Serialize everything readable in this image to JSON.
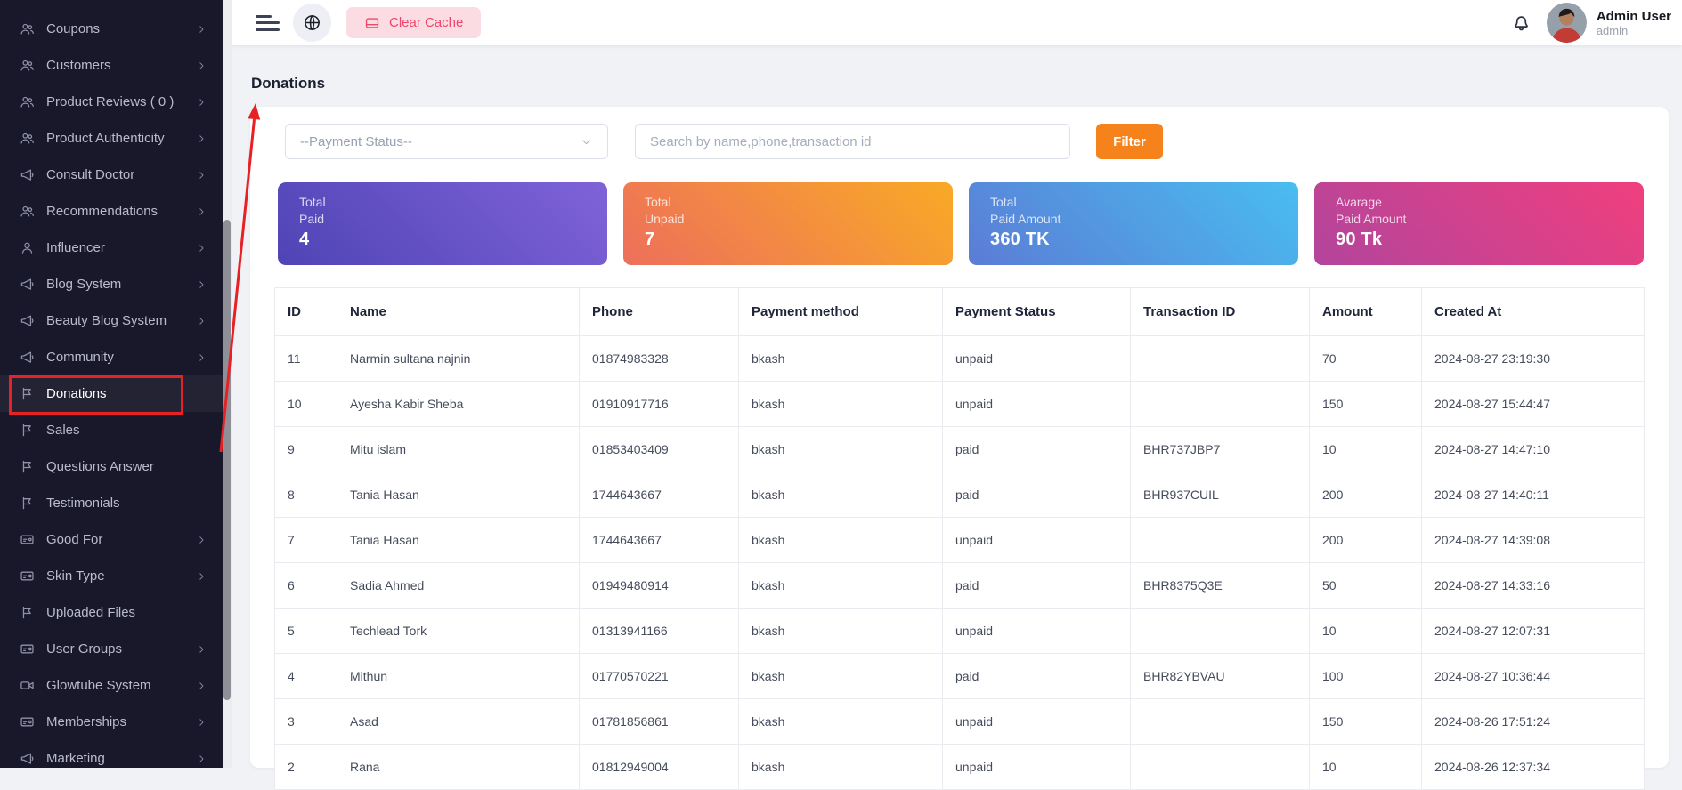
{
  "sidebar": {
    "items": [
      {
        "label": "Coupons",
        "icon": "users",
        "chevron": true,
        "active": false
      },
      {
        "label": "Customers",
        "icon": "users",
        "chevron": true,
        "active": false
      },
      {
        "label": "Product Reviews ( 0 )",
        "icon": "users",
        "chevron": true,
        "active": false
      },
      {
        "label": "Product Authenticity",
        "icon": "users",
        "chevron": true,
        "active": false
      },
      {
        "label": "Consult Doctor",
        "icon": "megaphone",
        "chevron": true,
        "active": false
      },
      {
        "label": "Recommendations",
        "icon": "users",
        "chevron": true,
        "active": false
      },
      {
        "label": "Influencer",
        "icon": "user",
        "chevron": true,
        "active": false
      },
      {
        "label": "Blog System",
        "icon": "megaphone",
        "chevron": true,
        "active": false
      },
      {
        "label": "Beauty Blog System",
        "icon": "megaphone",
        "chevron": true,
        "active": false
      },
      {
        "label": "Community",
        "icon": "megaphone",
        "chevron": true,
        "active": false
      },
      {
        "label": "Donations",
        "icon": "flag",
        "chevron": false,
        "active": true
      },
      {
        "label": "Sales",
        "icon": "flag",
        "chevron": false,
        "active": false
      },
      {
        "label": "Questions Answer",
        "icon": "flag",
        "chevron": false,
        "active": false
      },
      {
        "label": "Testimonials",
        "icon": "flag",
        "chevron": false,
        "active": false
      },
      {
        "label": "Good For",
        "icon": "card",
        "chevron": true,
        "active": false
      },
      {
        "label": "Skin Type",
        "icon": "card",
        "chevron": true,
        "active": false
      },
      {
        "label": "Uploaded Files",
        "icon": "flag",
        "chevron": false,
        "active": false
      },
      {
        "label": "User Groups",
        "icon": "card",
        "chevron": true,
        "active": false
      },
      {
        "label": "Glowtube System",
        "icon": "video",
        "chevron": true,
        "active": false
      },
      {
        "label": "Memberships",
        "icon": "card",
        "chevron": true,
        "active": false
      },
      {
        "label": "Marketing",
        "icon": "megaphone",
        "chevron": true,
        "active": false
      }
    ]
  },
  "topbar": {
    "clear_cache": "Clear Cache",
    "user": {
      "name": "Admin User",
      "role": "admin"
    }
  },
  "page": {
    "title": "Donations"
  },
  "filters": {
    "payment_status": "--Payment Status--",
    "search_placeholder": "Search by name,phone,transaction id",
    "submit": "Filter"
  },
  "stats": [
    {
      "label_line1": "Total",
      "label_line2": "Paid",
      "value": "4",
      "gradient_from": "#4f44b5",
      "gradient_to": "#7f63d8"
    },
    {
      "label_line1": "Total",
      "label_line2": "Unpaid",
      "value": "7",
      "gradient_from": "#ed6f5b",
      "gradient_to": "#f9aa26"
    },
    {
      "label_line1": "Total",
      "label_line2": "Paid Amount",
      "value": "360 TK",
      "gradient_from": "#5b7cd5",
      "gradient_to": "#49bdf0"
    },
    {
      "label_line1": "Avarage",
      "label_line2": "Paid Amount",
      "value": "90 Tk",
      "gradient_from": "#b2459c",
      "gradient_to": "#f03f7e"
    }
  ],
  "table": {
    "columns": [
      "ID",
      "Name",
      "Phone",
      "Payment method",
      "Payment Status",
      "Transaction ID",
      "Amount",
      "Created At"
    ],
    "rows": [
      [
        "11",
        "Narmin sultana najnin",
        "01874983328",
        "bkash",
        "unpaid",
        "",
        "70",
        "2024-08-27 23:19:30"
      ],
      [
        "10",
        "Ayesha Kabir Sheba",
        "01910917716",
        "bkash",
        "unpaid",
        "",
        "150",
        "2024-08-27 15:44:47"
      ],
      [
        "9",
        "Mitu islam",
        "01853403409",
        "bkash",
        "paid",
        "BHR737JBP7",
        "10",
        "2024-08-27 14:47:10"
      ],
      [
        "8",
        "Tania Hasan",
        "1744643667",
        "bkash",
        "paid",
        "BHR937CUIL",
        "200",
        "2024-08-27 14:40:11"
      ],
      [
        "7",
        "Tania Hasan",
        "1744643667",
        "bkash",
        "unpaid",
        "",
        "200",
        "2024-08-27 14:39:08"
      ],
      [
        "6",
        "Sadia Ahmed",
        "01949480914",
        "bkash",
        "paid",
        "BHR8375Q3E",
        "50",
        "2024-08-27 14:33:16"
      ],
      [
        "5",
        "Techlead Tork",
        "01313941166",
        "bkash",
        "unpaid",
        "",
        "10",
        "2024-08-27 12:07:31"
      ],
      [
        "4",
        "Mithun",
        "01770570221",
        "bkash",
        "paid",
        "BHR82YBVAU",
        "100",
        "2024-08-27 10:36:44"
      ],
      [
        "3",
        "Asad",
        "01781856861",
        "bkash",
        "unpaid",
        "",
        "150",
        "2024-08-26 17:51:24"
      ],
      [
        "2",
        "Rana",
        "01812949004",
        "bkash",
        "unpaid",
        "",
        "10",
        "2024-08-26 12:37:34"
      ]
    ]
  },
  "colors": {
    "sidebar_bg": "#18182a",
    "filter_button": "#f6821c",
    "clear_cache_bg": "#fbdce3",
    "clear_cache_text": "#ee476b",
    "annotation_red": "#e82127"
  }
}
